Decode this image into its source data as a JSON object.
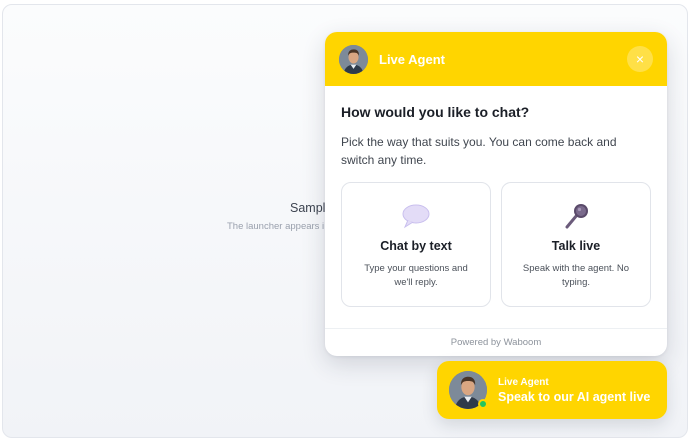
{
  "background_page": {
    "title": "Sample",
    "subtitle": "The launcher appears i"
  },
  "popup": {
    "header_title": "Live Agent",
    "close_glyph": "×",
    "question": "How would you like to chat?",
    "description": "Pick the way that suits you. You can come back and switch any time.",
    "options": [
      {
        "title": "Chat by text",
        "description": "Type your questions and we'll reply.",
        "icon": "speech-balloon-icon"
      },
      {
        "title": "Talk live",
        "description": "Speak with the agent. No typing.",
        "icon": "microphone-icon"
      }
    ],
    "footer": "Powered by Waboom"
  },
  "launcher": {
    "label": "Live Agent",
    "cta": "Speak to our AI agent live",
    "status": "online"
  },
  "colors": {
    "brand_yellow": "#ffd500",
    "online_green": "#22c55e",
    "text_dark": "#1b1f27"
  }
}
